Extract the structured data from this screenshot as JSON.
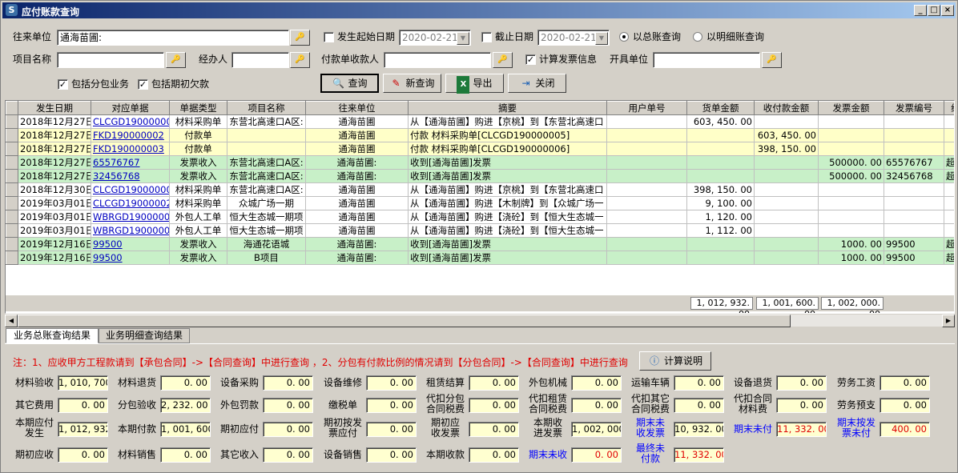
{
  "window": {
    "title": "应付账款查询",
    "min": "_",
    "max": "□",
    "close": "×"
  },
  "filters": {
    "vendor_label": "往来单位",
    "vendor_value": "通海苗圃:",
    "start_date_label": "发生起始日期",
    "start_date_value": "2020-02-21",
    "end_date_label": "截止日期",
    "end_date_value": "2020-02-21",
    "radio_total": "以总账查询",
    "radio_detail": "以明细账查询",
    "project_label": "项目名称",
    "handler_label": "经办人",
    "payee_label": "付款单收款人",
    "invoice_info_label": "计算发票信息",
    "issuer_label": "开具单位",
    "include_sub_label": "包括分包业务",
    "include_initial_label": "包括期初欠款"
  },
  "buttons": {
    "query": "查询",
    "new_query": "新查询",
    "export": "导出",
    "close": "关闭"
  },
  "grid": {
    "columns": [
      "发生日期",
      "对应单据",
      "单据类型",
      "项目名称",
      "往来单位",
      "摘要",
      "用户单号",
      "货单金额",
      "收付款金额",
      "发票金额",
      "发票编号",
      "经"
    ],
    "rows": [
      {
        "type": "w",
        "date": "2018年12月27日",
        "doc": "CLCGD190000005",
        "kind": "材料采购单",
        "project": "东营北高速口A区:",
        "unit": "通海苗圃",
        "summary": "从【通海苗圃】购进【京桃】到【东营北高速口",
        "user_no": "",
        "goods": "603, 450. 00",
        "paid": "",
        "inv_amt": "",
        "inv_no": "",
        "extra": ""
      },
      {
        "type": "y",
        "date": "2018年12月27日",
        "doc": "FKD190000002",
        "kind": "付款单",
        "project": "",
        "unit": "通海苗圃",
        "summary": "付款  材料采购单[CLCGD190000005]",
        "user_no": "",
        "goods": "",
        "paid": "603, 450. 00",
        "inv_amt": "",
        "inv_no": "",
        "extra": ""
      },
      {
        "type": "y",
        "date": "2018年12月27日",
        "doc": "FKD190000003",
        "kind": "付款单",
        "project": "",
        "unit": "通海苗圃",
        "summary": "付款  材料采购单[CLCGD190000006]",
        "user_no": "",
        "goods": "",
        "paid": "398, 150. 00",
        "inv_amt": "",
        "inv_no": "",
        "extra": ""
      },
      {
        "type": "g",
        "date": "2018年12月27日",
        "doc": "65576767",
        "kind": "发票收入",
        "project": "东营北高速口A区:",
        "unit": "通海苗圃:",
        "summary": "收到[通海苗圃]发票",
        "user_no": "",
        "goods": "",
        "paid": "",
        "inv_amt": "500000. 00",
        "inv_no": "65576767",
        "extra": "超"
      },
      {
        "type": "g",
        "date": "2018年12月27日",
        "doc": "32456768",
        "kind": "发票收入",
        "project": "东营北高速口A区:",
        "unit": "通海苗圃:",
        "summary": "收到[通海苗圃]发票",
        "user_no": "",
        "goods": "",
        "paid": "",
        "inv_amt": "500000. 00",
        "inv_no": "32456768",
        "extra": "超"
      },
      {
        "type": "w",
        "date": "2018年12月30日",
        "doc": "CLCGD190000006",
        "kind": "材料采购单",
        "project": "东营北高速口A区:",
        "unit": "通海苗圃",
        "summary": "从【通海苗圃】购进【京桃】到【东营北高速口",
        "user_no": "",
        "goods": "398, 150. 00",
        "paid": "",
        "inv_amt": "",
        "inv_no": "",
        "extra": ""
      },
      {
        "type": "w",
        "date": "2019年03月01日",
        "doc": "CLCGD190000022",
        "kind": "材料采购单",
        "project": "众城广场一期",
        "unit": "通海苗圃",
        "summary": "从【通海苗圃】购进【木制牌】到【众城广场一",
        "user_no": "",
        "goods": "9, 100. 00",
        "paid": "",
        "inv_amt": "",
        "inv_no": "",
        "extra": ""
      },
      {
        "type": "w",
        "date": "2019年03月01日",
        "doc": "WBRGD190000014",
        "kind": "外包人工单",
        "project": "恒大生态城一期项",
        "unit": "通海苗圃",
        "summary": "从【通海苗圃】购进【浇砼】到【恒大生态城一",
        "user_no": "",
        "goods": "1, 120. 00",
        "paid": "",
        "inv_amt": "",
        "inv_no": "",
        "extra": ""
      },
      {
        "type": "w",
        "date": "2019年03月01日",
        "doc": "WBRGD190000015",
        "kind": "外包人工单",
        "project": "恒大生态城一期项",
        "unit": "通海苗圃",
        "summary": "从【通海苗圃】购进【浇砼】到【恒大生态城一",
        "user_no": "",
        "goods": "1, 112. 00",
        "paid": "",
        "inv_amt": "",
        "inv_no": "",
        "extra": ""
      },
      {
        "type": "g",
        "date": "2019年12月16日",
        "doc": "99500",
        "kind": "发票收入",
        "project": "海通花语城",
        "unit": "通海苗圃:",
        "summary": "收到[通海苗圃]发票",
        "user_no": "",
        "goods": "",
        "paid": "",
        "inv_amt": "1000. 00",
        "inv_no": "99500",
        "extra": "超"
      },
      {
        "type": "g",
        "date": "2019年12月16日",
        "doc": "99500",
        "kind": "发票收入",
        "project": "B项目",
        "unit": "通海苗圃:",
        "summary": "收到[通海苗圃]发票",
        "user_no": "",
        "goods": "",
        "paid": "",
        "inv_amt": "1000. 00",
        "inv_no": "99500",
        "extra": "超"
      }
    ],
    "totals": {
      "goods": "1, 012, 932. 00",
      "paid": "1, 001, 600. 00",
      "inv_amt": "1, 002, 000. 00"
    }
  },
  "tabs": [
    "业务总账查询结果",
    "业务明细查询结果"
  ],
  "note": "注：1、应收甲方工程款请到【承包合同】->【合同查询】中进行查询 ，2、分包有付款比例的情况请到【分包合同】->【合同查询】中进行查询",
  "calc_button": "计算说明",
  "summary": [
    {
      "label": "材料验收",
      "value": "1, 010, 700.",
      "red": false,
      "blue": false
    },
    {
      "label": "材料退货",
      "value": "0. 00",
      "red": false,
      "blue": false
    },
    {
      "label": "设备采购",
      "value": "0. 00",
      "red": false,
      "blue": false
    },
    {
      "label": "设备维修",
      "value": "0. 00",
      "red": false,
      "blue": false
    },
    {
      "label": "租赁结算",
      "value": "0. 00",
      "red": false,
      "blue": false
    },
    {
      "label": "外包机械",
      "value": "0. 00",
      "red": false,
      "blue": false
    },
    {
      "label": "运输车辆",
      "value": "0. 00",
      "red": false,
      "blue": false
    },
    {
      "label": "设备退货",
      "value": "0. 00",
      "red": false,
      "blue": false
    },
    {
      "label": "劳务工资",
      "value": "0. 00",
      "red": false,
      "blue": false
    },
    {
      "label": "其它费用",
      "value": "0. 00",
      "red": false,
      "blue": false
    },
    {
      "label": "分包验收",
      "value": "2, 232. 00",
      "red": false,
      "blue": false
    },
    {
      "label": "外包罚款",
      "value": "0. 00",
      "red": false,
      "blue": false
    },
    {
      "label": "缴税单",
      "value": "0. 00",
      "red": false,
      "blue": false
    },
    {
      "label": "代扣分包\n合同税费",
      "value": "0. 00",
      "red": false,
      "blue": false
    },
    {
      "label": "代扣租赁\n合同税费",
      "value": "0. 00",
      "red": false,
      "blue": false
    },
    {
      "label": "代扣其它\n合同税费",
      "value": "0. 00",
      "red": false,
      "blue": false
    },
    {
      "label": "代扣合同\n材料费",
      "value": "0. 00",
      "red": false,
      "blue": false
    },
    {
      "label": "劳务预支",
      "value": "0. 00",
      "red": false,
      "blue": false
    },
    {
      "label": "本期应付\n发生",
      "value": "1, 012, 932.",
      "red": false,
      "blue": false
    },
    {
      "label": "本期付款",
      "value": "1, 001, 600.",
      "red": false,
      "blue": false
    },
    {
      "label": "期初应付",
      "value": "0. 00",
      "red": false,
      "blue": false
    },
    {
      "label": "期初按发\n票应付",
      "value": "0. 00",
      "red": false,
      "blue": false
    },
    {
      "label": "期初应\n收发票",
      "value": "0. 00",
      "red": false,
      "blue": false
    },
    {
      "label": "本期收\n进发票",
      "value": "1, 002, 000.",
      "red": false,
      "blue": false
    },
    {
      "label": "期末未\n收发票",
      "value": "10, 932. 00",
      "red": false,
      "blue": true
    },
    {
      "label": "期末未付",
      "value": "11, 332. 00",
      "red": true,
      "blue": true
    },
    {
      "label": "期末按发\n票未付",
      "value": "400. 00",
      "red": true,
      "blue": true
    },
    {
      "label": "期初应收",
      "value": "0. 00",
      "red": false,
      "blue": false
    },
    {
      "label": "材料销售",
      "value": "0. 00",
      "red": false,
      "blue": false
    },
    {
      "label": "其它收入",
      "value": "0. 00",
      "red": false,
      "blue": false
    },
    {
      "label": "设备销售",
      "value": "0. 00",
      "red": false,
      "blue": false
    },
    {
      "label": "本期收款",
      "value": "0. 00",
      "red": false,
      "blue": false
    },
    {
      "label": "期末未收",
      "value": "0. 00",
      "red": true,
      "blue": true
    },
    {
      "label": "最终未\n付款",
      "value": "11, 332. 00",
      "red": true,
      "blue": true
    }
  ],
  "colors": {
    "yellow_row": "#ffffc8",
    "green_row": "#c8f0c8",
    "link": "#0000c0",
    "note": "#e00000",
    "blue_label": "#0000ff"
  },
  "icons": {
    "app": "app-icon",
    "lookup": "lookup-icon",
    "query": "magnifier-icon",
    "new_query": "eraser-icon",
    "export": "excel-icon",
    "close": "door-icon",
    "info": "info-icon"
  }
}
